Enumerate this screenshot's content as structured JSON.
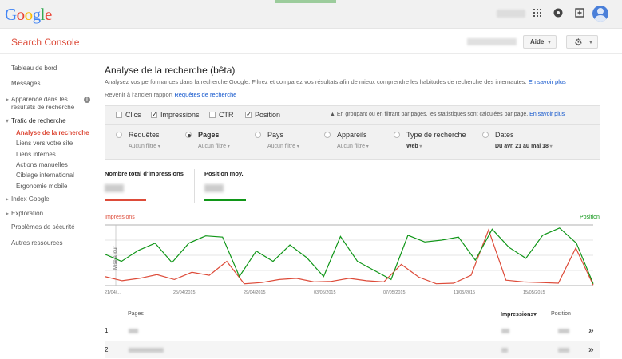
{
  "topbar": {
    "logo_letters": [
      "G",
      "o",
      "o",
      "g",
      "l",
      "e"
    ],
    "icons": [
      "apps-grid-icon",
      "notifications-icon",
      "share-plus-icon",
      "account-avatar-icon"
    ]
  },
  "header": {
    "product": "Search Console",
    "help_label": "Aide",
    "settings_icon": "gear-icon"
  },
  "sidebar": {
    "items": [
      {
        "label": "Tableau de bord"
      },
      {
        "label": "Messages"
      },
      {
        "label_line1": "Apparence dans les",
        "label_line2": "résultats de recherche"
      },
      {
        "label": "Trafic de recherche"
      },
      {
        "label": "Analyse de la recherche"
      },
      {
        "label": "Liens vers votre site"
      },
      {
        "label": "Liens internes"
      },
      {
        "label": "Actions manuelles"
      },
      {
        "label": "Ciblage international"
      },
      {
        "label": "Ergonomie mobile"
      },
      {
        "label": "Index Google"
      },
      {
        "label": "Exploration"
      },
      {
        "label": "Problèmes de sécurité"
      },
      {
        "label": "Autres ressources"
      }
    ],
    "info_badge": "i"
  },
  "main": {
    "title": "Analyse de la recherche (bêta)",
    "description": "Analysez vos performances dans la recherche Google. Filtrez et comparez vos résultats afin de mieux comprendre les habitudes de recherche des internautes.",
    "learn_more": "En savoir plus",
    "old_report_prefix": "Revenir à l'ancien rapport",
    "old_report_link": "Requêtes de recherche",
    "metrics": [
      {
        "label": "Clics",
        "checked": false
      },
      {
        "label": "Impressions",
        "checked": true
      },
      {
        "label": "CTR",
        "checked": false
      },
      {
        "label": "Position",
        "checked": true
      }
    ],
    "warning_text": "En groupant ou en filtrant par pages, les statistiques sont calculées par page.",
    "warning_link": "En savoir plus",
    "dimensions": [
      {
        "label": "Requêtes",
        "sub": "Aucun filtre",
        "selected": false
      },
      {
        "label": "Pages",
        "sub": "Aucun filtre",
        "selected": true
      },
      {
        "label": "Pays",
        "sub": "Aucun filtre",
        "selected": false
      },
      {
        "label": "Appareils",
        "sub": "Aucun filtre",
        "selected": false
      },
      {
        "label": "Type de recherche",
        "sub": "Web",
        "selected": false
      },
      {
        "label": "Dates",
        "sub": "Du avr. 21 au mai 18",
        "selected": false
      }
    ],
    "cards": [
      {
        "title": "Nombre total d'impressions",
        "color": "#dd4b39"
      },
      {
        "title": "Position moy.",
        "color": "#109618"
      }
    ],
    "table": {
      "col_pages": "Pages",
      "col_impressions": "Impressions▾",
      "col_position": "Position",
      "rows": [
        {
          "rank": "1"
        },
        {
          "rank": "2"
        }
      ]
    }
  },
  "chart_data": {
    "type": "line",
    "left_axis_label": "Impressions",
    "right_axis_label": "Position",
    "y_rotated_label": "Mise à jour",
    "x_tick_labels": [
      "21/04/...",
      "25/04/2015",
      "29/04/2015",
      "03/05/2015",
      "07/05/2015",
      "11/05/2015",
      "15/05/2015"
    ],
    "series": [
      {
        "name": "Impressions",
        "color": "#dd4b39",
        "values": [
          0.15,
          0.08,
          0.12,
          0.18,
          0.1,
          0.22,
          0.17,
          0.4,
          0.03,
          0.05,
          0.1,
          0.12,
          0.06,
          0.07,
          0.12,
          0.08,
          0.06,
          0.35,
          0.14,
          0.03,
          0.04,
          0.17,
          0.92,
          0.09,
          0.06,
          0.05,
          0.04,
          0.62,
          0.01
        ]
      },
      {
        "name": "Position",
        "color": "#109618",
        "values": [
          0.52,
          0.4,
          0.58,
          0.7,
          0.38,
          0.7,
          0.82,
          0.8,
          0.15,
          0.57,
          0.4,
          0.67,
          0.46,
          0.15,
          0.81,
          0.4,
          0.25,
          0.1,
          0.83,
          0.72,
          0.75,
          0.8,
          0.42,
          0.93,
          0.63,
          0.45,
          0.83,
          0.95,
          0.7,
          0.03
        ]
      }
    ]
  }
}
